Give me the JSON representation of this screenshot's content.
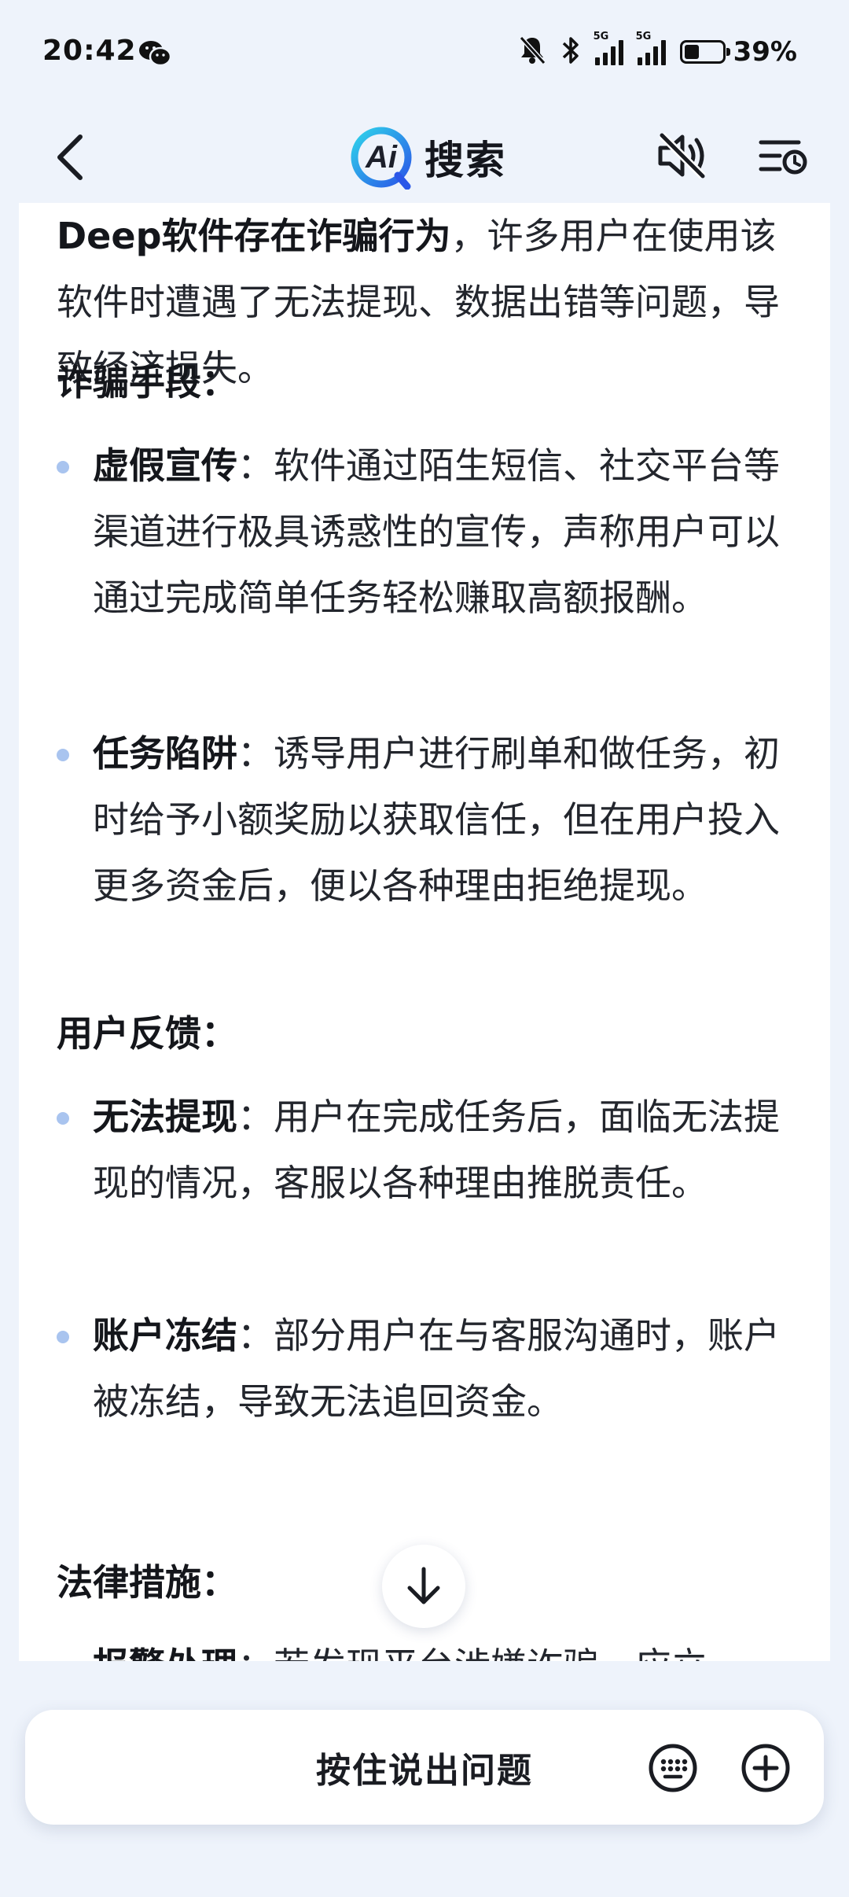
{
  "status_bar": {
    "time": "20:42",
    "signal1_tag": "5G",
    "signal2_tag": "5G",
    "battery_percent": "39%",
    "battery_level": 0.39,
    "icons": [
      "wechat-icon",
      "bell-muted-icon",
      "bluetooth-icon",
      "signal-5g-icon",
      "signal-5g-icon",
      "battery-icon"
    ]
  },
  "nav": {
    "logo_text": "Ai",
    "title": "搜索",
    "back_icon": "chevron-left-icon",
    "mute_icon": "speaker-muted-icon",
    "history_icon": "history-list-icon"
  },
  "content": {
    "intro_bold": "Deep软件存在诈骗行为",
    "intro_rest": "，许多用户在使用该软件时遭遇了无法提现、数据出错等问题，导致经济损失。",
    "sections": [
      {
        "heading": "诈骗手段：",
        "items": [
          {
            "term": "虚假宣传",
            "text": "：软件通过陌生短信、社交平台等渠道进行极具诱惑性的宣传，声称用户可以通过完成简单任务轻松赚取高额报酬。"
          },
          {
            "term": "任务陷阱",
            "text": "：诱导用户进行刷单和做任务，初时给予小额奖励以获取信任，但在用户投入更多资金后，便以各种理由拒绝提现。"
          }
        ]
      },
      {
        "heading": "用户反馈：",
        "items": [
          {
            "term": "无法提现",
            "text": "：用户在完成任务后，面临无法提现的情况，客服以各种理由推脱责任。"
          },
          {
            "term": "账户冻结",
            "text": "：部分用户在与客服沟通时，账户被冻结，导致无法追回资金。"
          }
        ]
      },
      {
        "heading": "法律措施：",
        "items": [
          {
            "term": "报警处理",
            "text": "：若发现平台涉嫌诈骗，应立"
          }
        ]
      }
    ]
  },
  "scroll_down_icon": "arrow-down-icon",
  "input_bar": {
    "hold_to_speak": "按住说出问题",
    "keyboard_icon": "keyboard-icon",
    "plus_icon": "plus-circle-icon"
  },
  "colors": {
    "background": "#eef3fb",
    "card": "#ffffff",
    "bullet": "#a9c4ef",
    "logo_ring_start": "#2fd3ea",
    "logo_ring_end": "#2a56e8"
  }
}
